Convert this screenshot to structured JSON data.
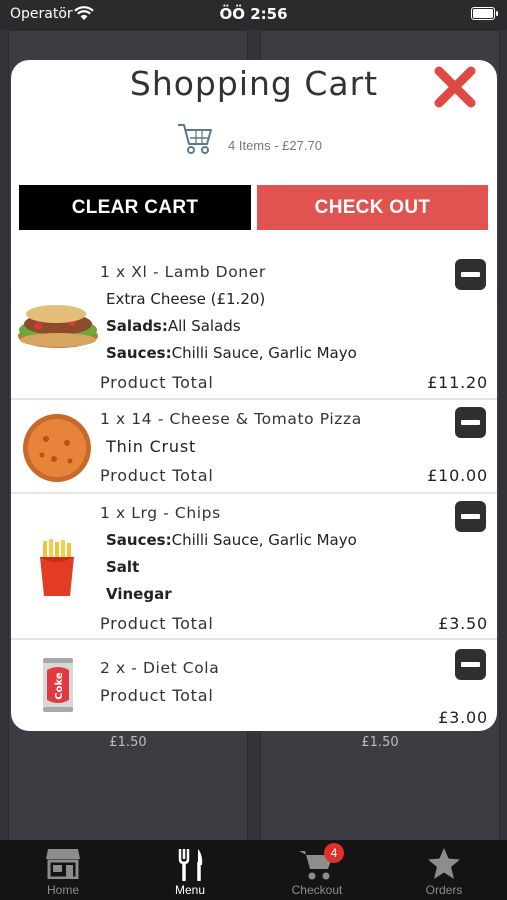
{
  "status_bar": {
    "carrier": "Operatör",
    "time": "ÖÖ 2:56"
  },
  "background": {
    "prices": [
      "£1.50",
      "£1.50"
    ]
  },
  "modal": {
    "title": "Shopping Cart",
    "summary": "4 Items - £27.70",
    "clear_label": "CLEAR CART",
    "checkout_label": "CHECK OUT",
    "total_label": "Product Total",
    "items": [
      {
        "name": "1 x Xl - Lamb Doner",
        "options": [
          {
            "key": "",
            "value": "Extra Cheese (£1.20)"
          },
          {
            "key": "Salads:",
            "value": "All Salads"
          },
          {
            "key": "Sauces:",
            "value": "Chilli Sauce, Garlic Mayo"
          }
        ],
        "total": "£11.20",
        "image_icon": "doner-kebab-icon"
      },
      {
        "name": "1 x 14 - Cheese & Tomato Pizza",
        "options": [
          {
            "key": "Thin Crust",
            "value": ""
          }
        ],
        "total": "£10.00",
        "image_icon": "pizza-icon"
      },
      {
        "name": "1 x Lrg - Chips",
        "options": [
          {
            "key": "Sauces:",
            "value": "Chilli Sauce, Garlic Mayo"
          },
          {
            "key": "Salt",
            "value": ""
          },
          {
            "key": "Vinegar",
            "value": ""
          }
        ],
        "total": "£3.50",
        "image_icon": "chips-icon"
      },
      {
        "name": "2 x - Diet Cola",
        "options": [],
        "total": "£3.00",
        "image_icon": "diet-cola-can-icon"
      }
    ]
  },
  "tab_bar": {
    "tabs": [
      {
        "label": "Home",
        "icon": "store-icon"
      },
      {
        "label": "Menu",
        "icon": "cutlery-icon"
      },
      {
        "label": "Checkout",
        "icon": "cart-icon",
        "badge": "4"
      },
      {
        "label": "Orders",
        "icon": "star-icon"
      }
    ]
  },
  "colors": {
    "checkout": "#e05350",
    "close": "#e04a45",
    "tab_bar": "#141414"
  }
}
